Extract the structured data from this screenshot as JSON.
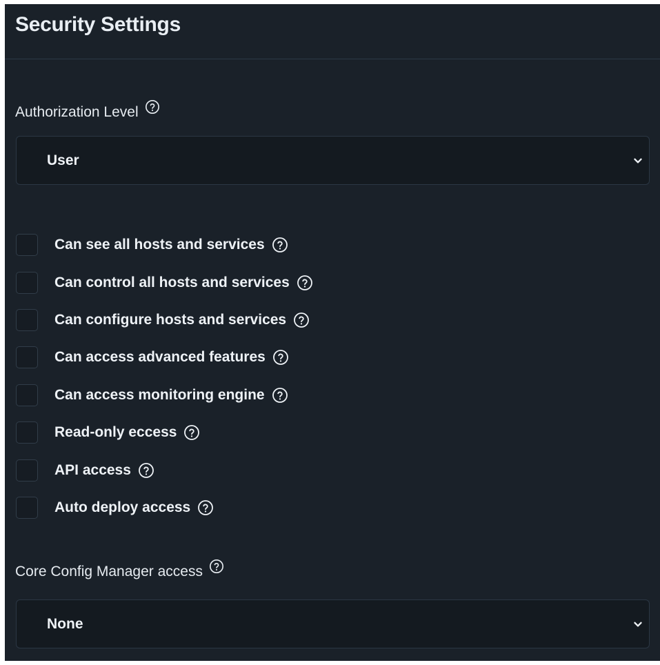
{
  "panel": {
    "title": "Security Settings"
  },
  "authorization_level": {
    "label": "Authorization Level",
    "help_icon": "help-circle-icon",
    "selected": "User",
    "dropdown_icon": "chevron-down-icon"
  },
  "permissions": [
    {
      "label": "Can see all hosts and services",
      "checked": false
    },
    {
      "label": "Can control all hosts and services",
      "checked": false
    },
    {
      "label": "Can configure hosts and services",
      "checked": false
    },
    {
      "label": "Can access advanced features",
      "checked": false
    },
    {
      "label": "Can access monitoring engine",
      "checked": false
    },
    {
      "label": "Read-only eccess",
      "checked": false
    },
    {
      "label": "API access",
      "checked": false
    },
    {
      "label": "Auto deploy access",
      "checked": false
    }
  ],
  "core_config_manager": {
    "label": "Core Config Manager access",
    "help_icon": "help-circle-icon",
    "selected": "None",
    "dropdown_icon": "chevron-down-icon"
  },
  "colors": {
    "panel_background": "#1a2129",
    "select_background": "#141a20",
    "border": "#2b3744",
    "text": "#eef2f6"
  }
}
